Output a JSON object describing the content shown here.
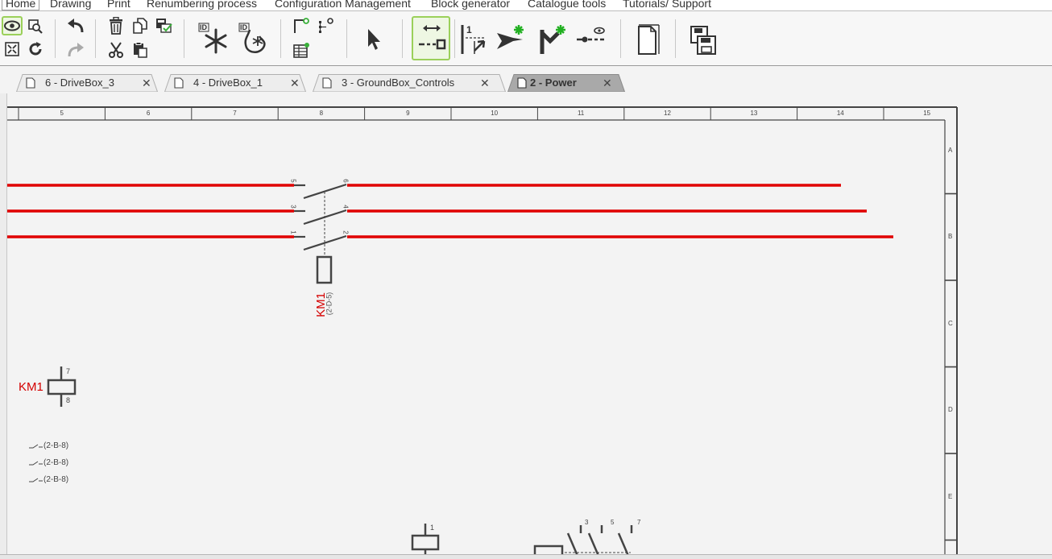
{
  "menu": {
    "items": [
      "Home",
      "Drawing",
      "Print",
      "Renumbering process",
      "Configuration Management",
      "Block generator",
      "Catalogue tools",
      "Tutorials/ Support"
    ]
  },
  "toolbar": {
    "icons": [
      "view-icon",
      "zoom-window-icon",
      "zoom-fit-icon",
      "refresh-icon",
      "undo-icon",
      "redo-icon",
      "delete-icon",
      "copy-icon",
      "cut-icon",
      "paste-icon",
      "validate-icon",
      "freeze-icon",
      "unfreeze-icon",
      "insert-page-icon",
      "navigate-icon",
      "page-list-icon",
      "select-arrow-icon",
      "connect-wire-icon",
      "cross-reference-icon",
      "insert-symbol-icon",
      "insert-contact-icon",
      "insert-wire-icon",
      "page-frame-icon",
      "save-all-icon"
    ]
  },
  "tabs": [
    {
      "label": "6 - DriveBox_3",
      "active": false
    },
    {
      "label": "4 - DriveBox_1",
      "active": false
    },
    {
      "label": "3 - GroundBox_Controls",
      "active": false
    },
    {
      "label": "2 - Power",
      "active": true
    }
  ],
  "drawing": {
    "columns": [
      "5",
      "6",
      "7",
      "8",
      "9",
      "10",
      "11",
      "12",
      "13",
      "14",
      "15"
    ],
    "rows": [
      "A",
      "B",
      "C",
      "D",
      "E"
    ],
    "contactor_pins_top": [
      "5",
      "3",
      "1"
    ],
    "contactor_pins_bottom": [
      "6",
      "4",
      "2"
    ],
    "contactor_ref": "KM1",
    "contactor_location": "(2-D-5)",
    "coil_ref": "KM1",
    "coil_pin_top": "7",
    "coil_pin_bottom": "8",
    "coil_contacts": [
      "(2-B-8)",
      "(2-B-8)",
      "(2-B-8)"
    ],
    "bottom_coil_pin": "1",
    "bottom_contacts_pins": [
      "3",
      "5",
      "7"
    ],
    "wire_color": "#e00000",
    "ref_color": "#d40000"
  }
}
